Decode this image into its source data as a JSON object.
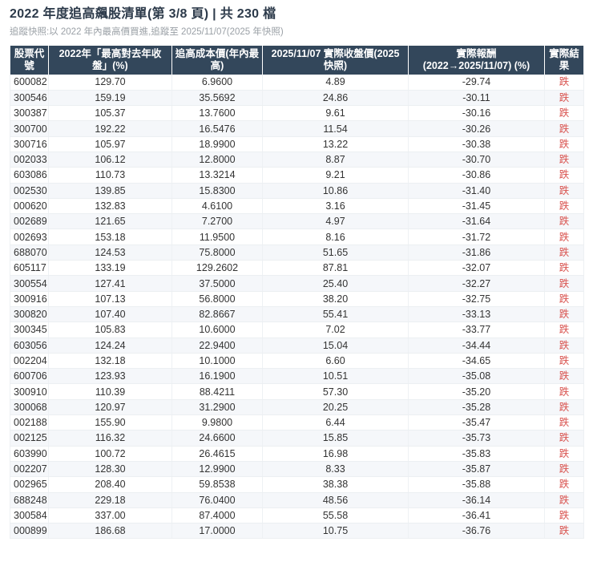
{
  "page": {
    "title": "2022 年度追高飆股清單(第 3/8 頁) | 共 230 檔",
    "subtitle": "追蹤快照:以 2022 年內最高價買進,追蹤至 2025/11/07(2025 年快照)"
  },
  "table": {
    "headers": [
      "股票代\n號",
      "2022年「最高對去年收\n盤」(%)",
      "追高成本價(年內最\n高)",
      "2025/11/07 實際收盤價(2025\n快照)",
      "實際報酬\n(2022→2025/11/07) (%)",
      "實際結\n果"
    ],
    "rows": [
      [
        "600082",
        "129.70",
        "6.9600",
        "4.89",
        "-29.74",
        "跌"
      ],
      [
        "300546",
        "159.19",
        "35.5692",
        "24.86",
        "-30.11",
        "跌"
      ],
      [
        "300387",
        "105.37",
        "13.7600",
        "9.61",
        "-30.16",
        "跌"
      ],
      [
        "300700",
        "192.22",
        "16.5476",
        "11.54",
        "-30.26",
        "跌"
      ],
      [
        "300716",
        "105.97",
        "18.9900",
        "13.22",
        "-30.38",
        "跌"
      ],
      [
        "002033",
        "106.12",
        "12.8000",
        "8.87",
        "-30.70",
        "跌"
      ],
      [
        "603086",
        "110.73",
        "13.3214",
        "9.21",
        "-30.86",
        "跌"
      ],
      [
        "002530",
        "139.85",
        "15.8300",
        "10.86",
        "-31.40",
        "跌"
      ],
      [
        "000620",
        "132.83",
        "4.6100",
        "3.16",
        "-31.45",
        "跌"
      ],
      [
        "002689",
        "121.65",
        "7.2700",
        "4.97",
        "-31.64",
        "跌"
      ],
      [
        "002693",
        "153.18",
        "11.9500",
        "8.16",
        "-31.72",
        "跌"
      ],
      [
        "688070",
        "124.53",
        "75.8000",
        "51.65",
        "-31.86",
        "跌"
      ],
      [
        "605117",
        "133.19",
        "129.2602",
        "87.81",
        "-32.07",
        "跌"
      ],
      [
        "300554",
        "127.41",
        "37.5000",
        "25.40",
        "-32.27",
        "跌"
      ],
      [
        "300916",
        "107.13",
        "56.8000",
        "38.20",
        "-32.75",
        "跌"
      ],
      [
        "300820",
        "107.40",
        "82.8667",
        "55.41",
        "-33.13",
        "跌"
      ],
      [
        "300345",
        "105.83",
        "10.6000",
        "7.02",
        "-33.77",
        "跌"
      ],
      [
        "603056",
        "124.24",
        "22.9400",
        "15.04",
        "-34.44",
        "跌"
      ],
      [
        "002204",
        "132.18",
        "10.1000",
        "6.60",
        "-34.65",
        "跌"
      ],
      [
        "600706",
        "123.93",
        "16.1900",
        "10.51",
        "-35.08",
        "跌"
      ],
      [
        "300910",
        "110.39",
        "88.4211",
        "57.30",
        "-35.20",
        "跌"
      ],
      [
        "300068",
        "120.97",
        "31.2900",
        "20.25",
        "-35.28",
        "跌"
      ],
      [
        "002188",
        "155.90",
        "9.9800",
        "6.44",
        "-35.47",
        "跌"
      ],
      [
        "002125",
        "116.32",
        "24.6600",
        "15.85",
        "-35.73",
        "跌"
      ],
      [
        "603990",
        "100.72",
        "26.4615",
        "16.98",
        "-35.83",
        "跌"
      ],
      [
        "002207",
        "128.30",
        "12.9900",
        "8.33",
        "-35.87",
        "跌"
      ],
      [
        "002965",
        "208.40",
        "59.8538",
        "38.38",
        "-35.88",
        "跌"
      ],
      [
        "688248",
        "229.18",
        "76.0400",
        "48.56",
        "-36.14",
        "跌"
      ],
      [
        "300584",
        "337.00",
        "87.4000",
        "55.58",
        "-36.41",
        "跌"
      ],
      [
        "000899",
        "186.68",
        "17.0000",
        "10.75",
        "-36.76",
        "跌"
      ]
    ]
  },
  "colors": {
    "header_bg": "#33475b",
    "header_text": "#ffffff",
    "down_red": "#d9534f",
    "title_text": "#2c3a4a",
    "subtitle_text": "#9aa0a6",
    "stripe_bg": "#f5f7fa"
  }
}
